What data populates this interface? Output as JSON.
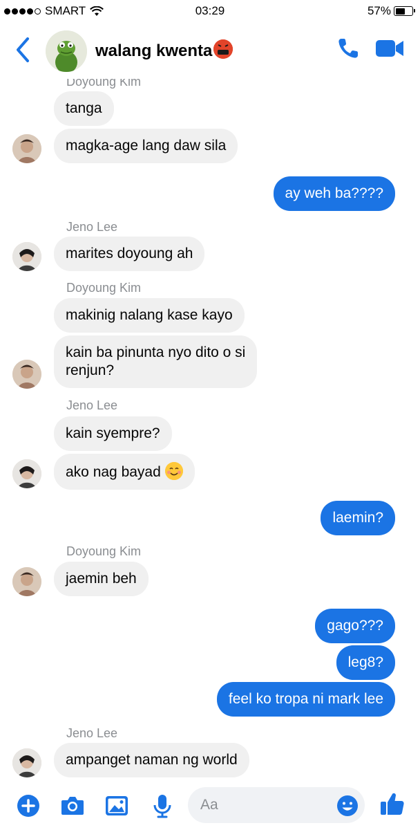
{
  "status_bar": {
    "carrier": "SMART",
    "time": "03:29",
    "battery": "57%",
    "battery_level": 0.57
  },
  "header": {
    "title": "walang kwenta"
  },
  "messages": [
    {
      "sender": "Doyoung Kim",
      "text": "tanga"
    },
    {
      "text": "magka-age lang daw sila"
    },
    {
      "direction": "out",
      "text": "ay weh ba????"
    },
    {
      "sender": "Jeno Lee",
      "text": "marites doyoung ah"
    },
    {
      "sender": "Doyoung Kim",
      "text": "makinig nalang kase kayo"
    },
    {
      "text_line1": "kain ba pinunta nyo dito o si",
      "text_line2": "renjun?"
    },
    {
      "sender": "Jeno Lee",
      "text": "kain syempre?"
    },
    {
      "text": "ako nag bayad"
    },
    {
      "direction": "out",
      "text": "laemin?"
    },
    {
      "sender": "Doyoung Kim",
      "text": "jaemin beh"
    },
    {
      "direction": "out",
      "text": "gago???"
    },
    {
      "direction": "out",
      "text": "leg8?"
    },
    {
      "direction": "out",
      "text": "feel ko tropa ni mark lee"
    },
    {
      "sender": "Jeno Lee",
      "text": "ampanget naman ng world"
    }
  ],
  "composer": {
    "placeholder": "Aa"
  },
  "colors": {
    "accent": "#1b74e4",
    "incoming_bubble": "#f0f0f0",
    "name_gray": "#8a8d91"
  }
}
